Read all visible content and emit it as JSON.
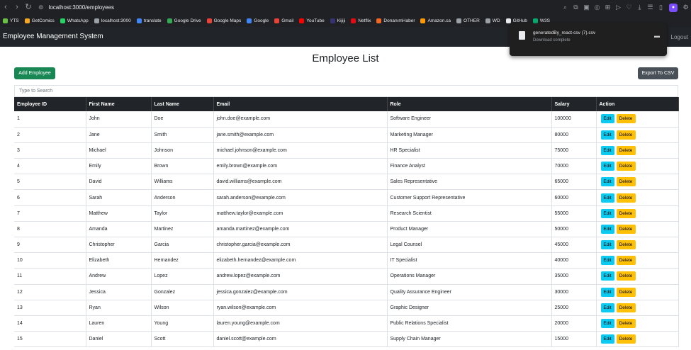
{
  "browser": {
    "url": "localhost:3000/employees",
    "bookmarks": [
      {
        "label": "YTS",
        "color": "#6ac045"
      },
      {
        "label": "GetComics",
        "color": "#f5a623"
      },
      {
        "label": "WhatsApp",
        "color": "#25d366"
      },
      {
        "label": "localhost:3000",
        "color": "#9aa0a6"
      },
      {
        "label": "translate",
        "color": "#4285f4"
      },
      {
        "label": "Google Drive",
        "color": "#34a853"
      },
      {
        "label": "Google Maps",
        "color": "#ea4335"
      },
      {
        "label": "Google",
        "color": "#4285f4"
      },
      {
        "label": "Gmail",
        "color": "#ea4335"
      },
      {
        "label": "YouTube",
        "color": "#ff0000"
      },
      {
        "label": "Kijiji",
        "color": "#373373"
      },
      {
        "label": "Netflix",
        "color": "#e50914"
      },
      {
        "label": "DonanımHaber",
        "color": "#f26722"
      },
      {
        "label": "Amazon.ca",
        "color": "#ff9900"
      },
      {
        "label": "OTHER",
        "color": "#9aa0a6"
      },
      {
        "label": "WD",
        "color": "#9aa0a6"
      },
      {
        "label": "GitHub",
        "color": "#e8eaed"
      },
      {
        "label": "W3S",
        "color": "#04aa6d"
      }
    ]
  },
  "download": {
    "filename": "generatedBy_react-csv (7).csv",
    "status": "Download complete"
  },
  "navbar": {
    "brand": "Employee Management System",
    "logout": "Logout"
  },
  "page": {
    "title": "Employee List",
    "add_button": "Add Employee",
    "export_button": "Export To CSV",
    "search_placeholder": "Type to Search"
  },
  "table": {
    "headers": [
      "Employee ID",
      "First Name",
      "Last Name",
      "Email",
      "Role",
      "Salary",
      "Action"
    ],
    "edit_label": "Edit",
    "delete_label": "Delete",
    "rows": [
      {
        "id": "1",
        "first": "John",
        "last": "Doe",
        "email": "john.doe@example.com",
        "role": "Software Engineer",
        "salary": "100000"
      },
      {
        "id": "2",
        "first": "Jane",
        "last": "Smith",
        "email": "jane.smith@example.com",
        "role": "Marketing Manager",
        "salary": "80000"
      },
      {
        "id": "3",
        "first": "Michael",
        "last": "Johnson",
        "email": "michael.johnson@example.com",
        "role": "HR Specialist",
        "salary": "75000"
      },
      {
        "id": "4",
        "first": "Emily",
        "last": "Brown",
        "email": "emily.brown@example.com",
        "role": "Finance Analyst",
        "salary": "70000"
      },
      {
        "id": "5",
        "first": "David",
        "last": "Williams",
        "email": "david.williams@example.com",
        "role": "Sales Representative",
        "salary": "65000"
      },
      {
        "id": "6",
        "first": "Sarah",
        "last": "Anderson",
        "email": "sarah.anderson@example.com",
        "role": "Customer Support Representative",
        "salary": "60000"
      },
      {
        "id": "7",
        "first": "Matthew",
        "last": "Taylor",
        "email": "matthew.taylor@example.com",
        "role": "Research Scientist",
        "salary": "55000"
      },
      {
        "id": "8",
        "first": "Amanda",
        "last": "Martinez",
        "email": "amanda.martinez@example.com",
        "role": "Product Manager",
        "salary": "50000"
      },
      {
        "id": "9",
        "first": "Christopher",
        "last": "Garcia",
        "email": "christopher.garcia@example.com",
        "role": "Legal Counsel",
        "salary": "45000"
      },
      {
        "id": "10",
        "first": "Elizabeth",
        "last": "Hernandez",
        "email": "elizabeth.hernandez@example.com",
        "role": "IT Specialist",
        "salary": "40000"
      },
      {
        "id": "11",
        "first": "Andrew",
        "last": "Lopez",
        "email": "andrew.lopez@example.com",
        "role": "Operations Manager",
        "salary": "35000"
      },
      {
        "id": "12",
        "first": "Jessica",
        "last": "Gonzalez",
        "email": "jessica.gonzalez@example.com",
        "role": "Quality Assurance Engineer",
        "salary": "30000"
      },
      {
        "id": "13",
        "first": "Ryan",
        "last": "Wilson",
        "email": "ryan.wilson@example.com",
        "role": "Graphic Designer",
        "salary": "25000"
      },
      {
        "id": "14",
        "first": "Lauren",
        "last": "Young",
        "email": "lauren.young@example.com",
        "role": "Public Relations Specialist",
        "salary": "20000"
      },
      {
        "id": "15",
        "first": "Daniel",
        "last": "Scott",
        "email": "daniel.scott@example.com",
        "role": "Supply Chain Manager",
        "salary": "15000"
      }
    ]
  }
}
